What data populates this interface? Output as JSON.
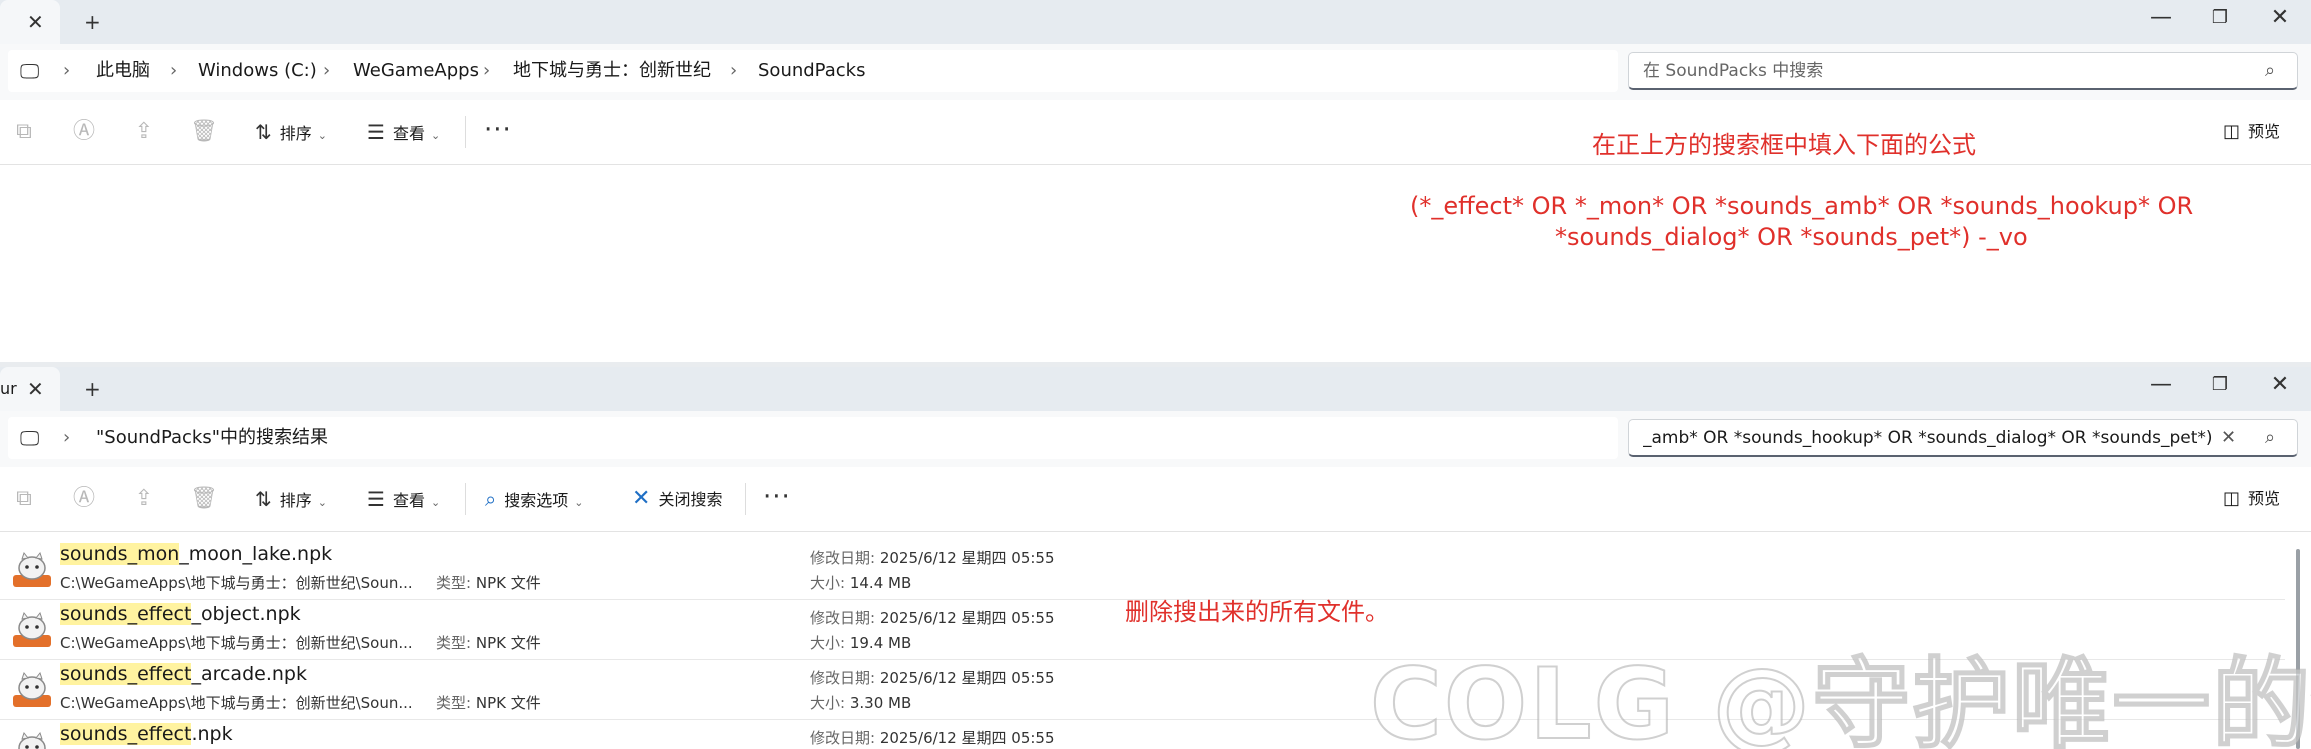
{
  "window_top": {
    "breadcrumbs": [
      "此电脑",
      "Windows (C:)",
      "WeGameApps",
      "地下城与勇士：创新世纪",
      "SoundPacks"
    ],
    "search": {
      "placeholder": "在 SoundPacks 中搜索"
    },
    "toolbar": {
      "sort_label": "排序",
      "view_label": "查看",
      "preview_label": "预览"
    },
    "annotation": {
      "heading": "在正上方的搜索框中填入下面的公式",
      "formula_line1": "(*_effect* OR *_mon* OR *sounds_amb* OR *sounds_hookup* OR",
      "formula_line2": "*sounds_dialog* OR *sounds_pet*)  -_vo"
    }
  },
  "window_bottom": {
    "tab_fragment": "ur",
    "location": "\"SoundPacks\"中的搜索结果",
    "search": {
      "value": "_amb* OR *sounds_hookup* OR *sounds_dialog* OR *sounds_pet*)  -_vo"
    },
    "toolbar": {
      "sort_label": "排序",
      "view_label": "查看",
      "search_options_label": "搜索选项",
      "close_search_label": "关闭搜索",
      "preview_label": "预览"
    },
    "annotation": "删除搜出来的所有文件。",
    "labels": {
      "modified": "修改日期:",
      "size": "大小:",
      "type": "类型:"
    },
    "files": [
      {
        "name_highlight": "sounds_mon",
        "name_rest": "_moon_lake.npk",
        "path": "C:\\WeGameApps\\地下城与勇士：创新世纪\\Soun...",
        "type": "NPK 文件",
        "modified": "2025/6/12 星期四 05:55",
        "size": "14.4 MB"
      },
      {
        "name_highlight": "sounds_effect",
        "name_rest": "_object.npk",
        "path": "C:\\WeGameApps\\地下城与勇士：创新世纪\\Soun...",
        "type": "NPK 文件",
        "modified": "2025/6/12 星期四 05:55",
        "size": "19.4 MB"
      },
      {
        "name_highlight": "sounds_effect",
        "name_rest": "_arcade.npk",
        "path": "C:\\WeGameApps\\地下城与勇士：创新世纪\\Soun...",
        "type": "NPK 文件",
        "modified": "2025/6/12 星期四 05:55",
        "size": "3.30 MB"
      },
      {
        "name_highlight": "sounds_effect",
        "name_rest": ".npk",
        "modified": "2025/6/12 星期四 05:55"
      }
    ]
  },
  "watermark": "COLG @守护唯一的你",
  "colors": {
    "annotation": "#e0302b",
    "highlight": "#fff3a0",
    "titlebar": "#e6ebf0"
  }
}
